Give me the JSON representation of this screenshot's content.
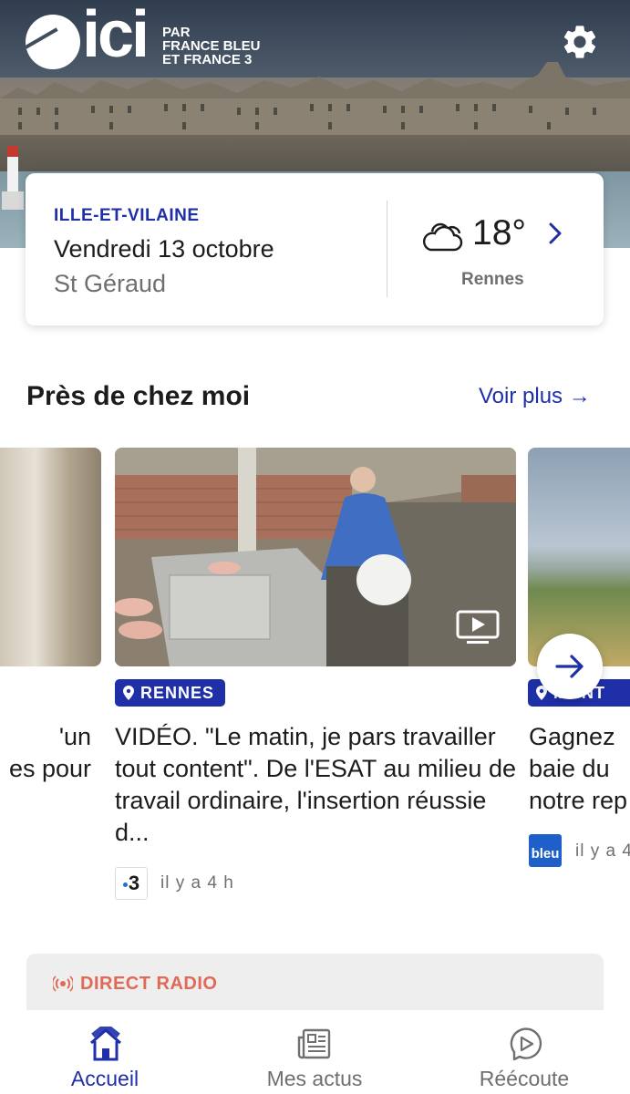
{
  "header": {
    "logo_text": "ici",
    "logo_tagline": [
      "PAR",
      "FRANCE BLEU",
      "ET FRANCE 3"
    ],
    "settings_icon": "gear-icon"
  },
  "weather_card": {
    "region": "ILLE-ET-VILAINE",
    "date": "Vendredi 13 octobre",
    "saint": "St Géraud",
    "temperature": "18°",
    "city": "Rennes",
    "weather_icon": "cloud-icon"
  },
  "near_me": {
    "title": "Près de chez moi",
    "see_more": "Voir plus →",
    "articles": [
      {
        "headline": "'un\nes pour"
      },
      {
        "location": "RENNES",
        "headline": "VIDÉO. \"Le matin, je pars travailler tout content\". De l'ESAT au milieu de travail ordinaire, l'insertion réussie d...",
        "source_logo": "3",
        "time": "il y a 4 h"
      },
      {
        "location": "MONT",
        "headline": "Gagnez\nbaie du\nnotre rep",
        "source_logo": "bleu",
        "time": "il y a 4"
      }
    ]
  },
  "direct_radio": {
    "label": "DIRECT RADIO"
  },
  "bottom_nav": {
    "items": [
      {
        "label": "Accueil",
        "icon": "house-icon",
        "active": true
      },
      {
        "label": "Mes actus",
        "icon": "newspaper-icon",
        "active": false
      },
      {
        "label": "Réécoute",
        "icon": "replay-icon",
        "active": false
      }
    ]
  },
  "colors": {
    "brand_blue": "#1f2fa8",
    "live_red": "#e06a55",
    "muted_text": "#6f6f6f"
  }
}
